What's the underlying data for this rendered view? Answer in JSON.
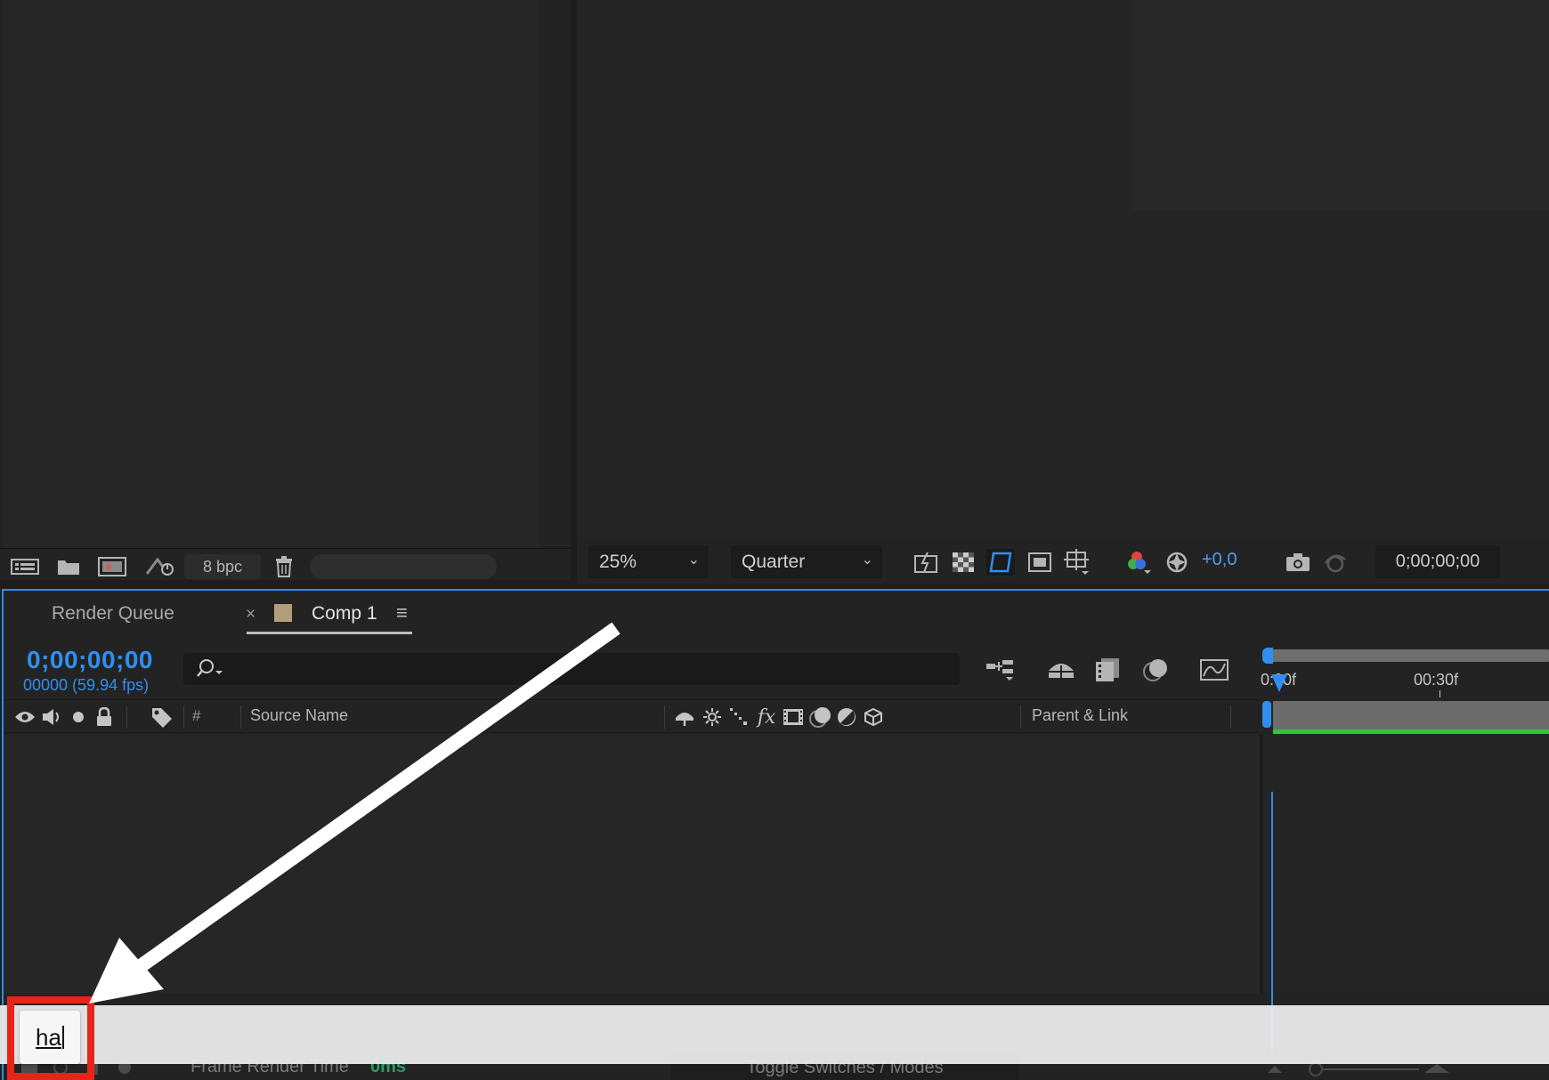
{
  "project": {
    "bpc_label": "8 bpc"
  },
  "viewer": {
    "zoom_value": "25%",
    "resolution_value": "Quarter",
    "exposure_value": "+0,0",
    "timecode": "0;00;00;00"
  },
  "timeline": {
    "tabs": [
      {
        "label": "Render Queue"
      },
      {
        "label": "Comp 1"
      }
    ],
    "current_time": "0;00;00;00",
    "frame_fps": "00000 (59.94 fps)",
    "columns": {
      "hash": "#",
      "source_name": "Source Name",
      "parent_link": "Parent & Link"
    },
    "ruler": {
      "label_0": "0:00f",
      "label_30": "00:30f"
    },
    "footer": {
      "frame_render_time_label": "Frame Render Time",
      "frame_render_time_value": "0ms",
      "toggle_label": "Toggle Switches / Modes"
    }
  },
  "overlay": {
    "typed_text": "ha"
  },
  "colors": {
    "accent": "#2f8ff0",
    "highlight_box": "#e8231a",
    "work_area_green": "#35c339",
    "comp_swatch": "#b39e7a"
  }
}
